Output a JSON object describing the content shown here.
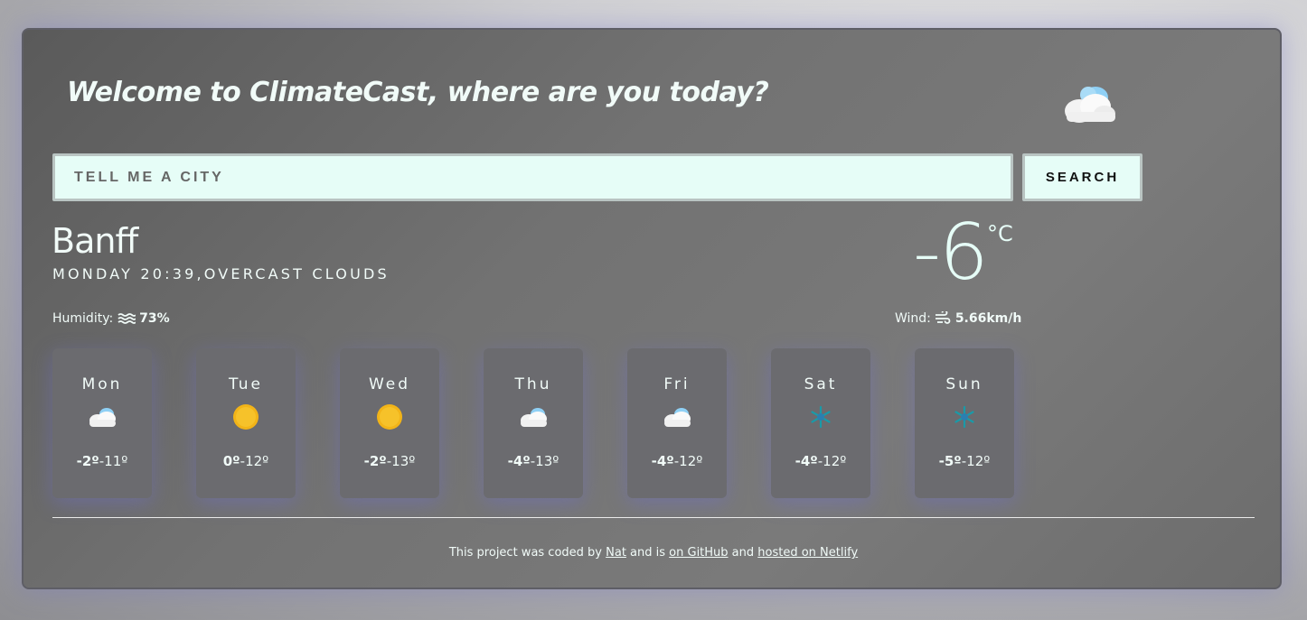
{
  "welcome": "Welcome to ClimateCast, where are you today?",
  "hero_icon": "cloud-icon",
  "search": {
    "placeholder": "TELL ME A CITY",
    "value": "",
    "button_label": "SEARCH"
  },
  "current": {
    "city": "Banff",
    "description": "MONDAY 20:39,OVERCAST CLOUDS",
    "temperature": "-6",
    "unit": "°C",
    "humidity_label": "Humidity:",
    "humidity_value": "73%",
    "wind_label": "Wind:",
    "wind_value": "5.66km/h"
  },
  "forecast": [
    {
      "day": "Mon",
      "icon": "cloud-icon",
      "max": "-2º",
      "min": "-11º"
    },
    {
      "day": "Tue",
      "icon": "sun-icon",
      "max": "0º",
      "min": "-12º"
    },
    {
      "day": "Wed",
      "icon": "sun-icon",
      "max": "-2º",
      "min": "-13º"
    },
    {
      "day": "Thu",
      "icon": "cloud-icon",
      "max": "-4º",
      "min": "-13º"
    },
    {
      "day": "Fri",
      "icon": "cloud-icon",
      "max": "-4º",
      "min": "-12º"
    },
    {
      "day": "Sat",
      "icon": "snowflake-icon",
      "max": "-4º",
      "min": "-12º"
    },
    {
      "day": "Sun",
      "icon": "snowflake-icon",
      "max": "-5º",
      "min": "-12º"
    }
  ],
  "footer": {
    "prefix": "This project was coded by ",
    "author_link": "Nat",
    "middle": " and is ",
    "github_link": "on GitHub",
    "and": " and ",
    "netlify_link": "hosted on Netlify"
  }
}
